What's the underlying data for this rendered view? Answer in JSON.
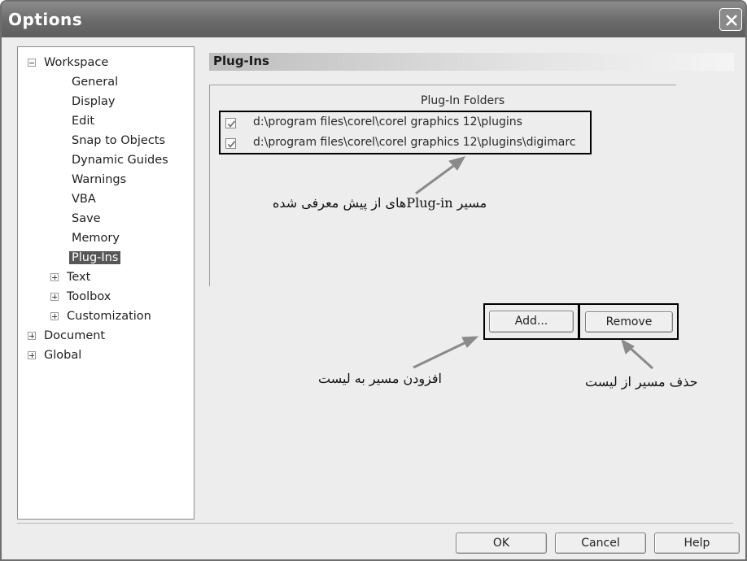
{
  "window": {
    "title": "Options"
  },
  "tree": {
    "items": [
      {
        "label": "Workspace",
        "expander": "minus"
      },
      {
        "label": "General"
      },
      {
        "label": "Display"
      },
      {
        "label": "Edit"
      },
      {
        "label": "Snap to Objects"
      },
      {
        "label": "Dynamic Guides"
      },
      {
        "label": "Warnings"
      },
      {
        "label": "VBA"
      },
      {
        "label": "Save"
      },
      {
        "label": "Memory"
      },
      {
        "label": "Plug-Ins",
        "selected": true
      },
      {
        "label": "Text",
        "expander": "plus"
      },
      {
        "label": "Toolbox",
        "expander": "plus"
      },
      {
        "label": "Customization",
        "expander": "plus"
      },
      {
        "label": "Document",
        "expander": "plus"
      },
      {
        "label": "Global",
        "expander": "plus"
      }
    ]
  },
  "panel": {
    "title": "Plug-Ins",
    "group_title": "Plug-In Folders",
    "folders": [
      {
        "path": "d:\\program files\\corel\\corel graphics 12\\plugins",
        "checked": true
      },
      {
        "path": "d:\\program files\\corel\\corel graphics 12\\plugins\\digimarc",
        "checked": true
      }
    ]
  },
  "buttons": {
    "add": "Add...",
    "remove": "Remove",
    "ok": "OK",
    "cancel": "Cancel",
    "help": "Help"
  },
  "annotations": {
    "folders_note": "مسیر Plug-inهای از پیش معرفی شده",
    "add_note": "افزودن مسیر به لیست",
    "remove_note": "حذف مسیر از لیست"
  },
  "icons": {
    "close": "close-icon",
    "checkbox": "checkmark-icon",
    "expander_plus": "plus-icon",
    "expander_minus": "minus-icon"
  }
}
